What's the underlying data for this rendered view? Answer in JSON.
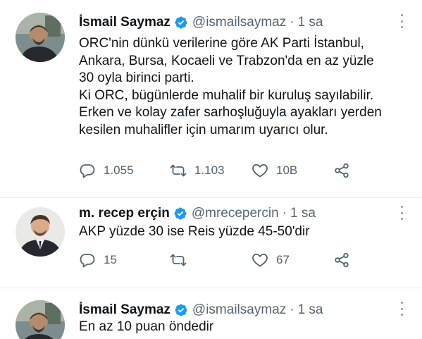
{
  "colors": {
    "verified": "#1d9bf0",
    "text": "#0f1419",
    "muted": "#536471",
    "divider": "#e8ecef"
  },
  "tweets": [
    {
      "name": "İsmail Saymaz",
      "handle": "@ismailsaymaz",
      "separator": "·",
      "time": "1 sa",
      "lines": [
        "ORC'nin dünkü verilerine göre AK Parti İstanbul,",
        "Ankara, Bursa, Kocaeli ve Trabzon'da en az yüzle",
        "30 oyla birinci parti.",
        "Ki ORC, bügünlerde muhalif bir kuruluş sayılabilir.",
        "Erken ve kolay zafer sarhoşluğuyla ayakları yerden",
        "kesilen muhalifler için umarım uyarıcı olur."
      ],
      "replies": "1.055",
      "retweets": "1.103",
      "likes": "10B",
      "icons": [
        "reply-icon",
        "retweet-icon",
        "like-icon",
        "share-icon",
        "verified-icon",
        "more-icon"
      ]
    },
    {
      "name": "m. recep erçin",
      "handle": "@mrecepercin",
      "separator": "·",
      "time": "1 sa",
      "lines": [
        "AKP yüzde 30 ise Reis yüzde 45-50'dir"
      ],
      "replies": "15",
      "retweets": "",
      "likes": "67"
    },
    {
      "name": "İsmail Saymaz",
      "handle": "@ismailsaymaz",
      "separator": "·",
      "time": "1 sa",
      "lines": [
        "En az 10 puan öndedir"
      ]
    }
  ]
}
